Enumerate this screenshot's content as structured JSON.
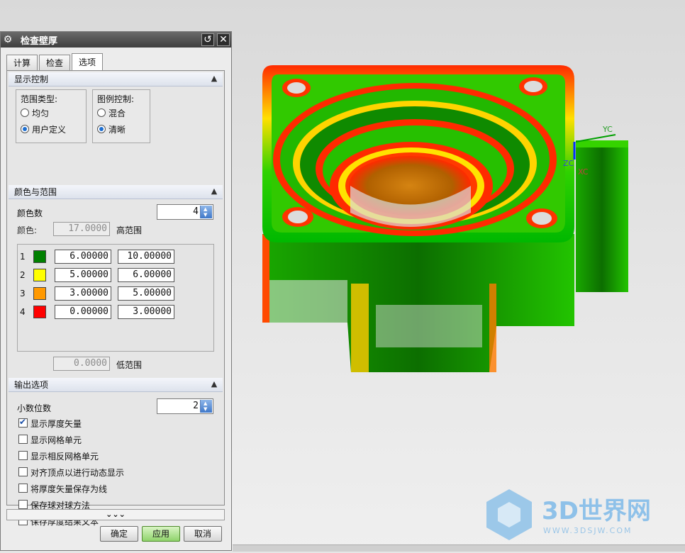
{
  "dialog": {
    "title": "检查壁厚",
    "tabs": [
      {
        "label": "计算",
        "active": false
      },
      {
        "label": "检查",
        "active": false
      },
      {
        "label": "选项",
        "active": true
      }
    ],
    "display_control": {
      "header": "显示控制",
      "range_type": {
        "label": "范围类型:",
        "options": [
          {
            "label": "均匀",
            "selected": false
          },
          {
            "label": "用户定义",
            "selected": true
          }
        ]
      },
      "legend_control": {
        "label": "图例控制:",
        "options": [
          {
            "label": "混合",
            "selected": false
          },
          {
            "label": "清晰",
            "selected": true
          }
        ]
      }
    },
    "color_range": {
      "header": "颜色与范围",
      "color_count_label": "颜色数",
      "color_count_value": "4",
      "color_label": "颜色:",
      "color_high_value": "17.0000",
      "high_range_label": "高范围",
      "rows": [
        {
          "index": "1",
          "color": "#008000",
          "low": "6.00000",
          "high": "10.00000"
        },
        {
          "index": "2",
          "color": "#ffff00",
          "low": "5.00000",
          "high": "6.00000"
        },
        {
          "index": "3",
          "color": "#ff9900",
          "low": "3.00000",
          "high": "5.00000"
        },
        {
          "index": "4",
          "color": "#ff0000",
          "low": "0.00000",
          "high": "3.00000"
        }
      ],
      "low_value": "0.0000",
      "low_range_label": "低范围"
    },
    "output": {
      "header": "输出选项",
      "decimal_label": "小数位数",
      "decimal_value": "2",
      "checkboxes": [
        {
          "label": "显示厚度矢量",
          "checked": true
        },
        {
          "label": "显示网格单元",
          "checked": false
        },
        {
          "label": "显示相反网格单元",
          "checked": false
        },
        {
          "label": "对齐顶点以进行动态显示",
          "checked": false
        },
        {
          "label": "将厚度矢量保存为线",
          "checked": false
        },
        {
          "label": "保存球对球方法",
          "checked": false
        },
        {
          "label": "保存厚度结果文本",
          "checked": false
        }
      ]
    },
    "more_glyph": "⌄⌄⌄",
    "buttons": {
      "ok": "确定",
      "apply": "应用",
      "cancel": "取消"
    }
  },
  "viewport": {
    "axis_labels": {
      "yc": "YC",
      "zc": "ZC",
      "xc": "XC"
    }
  },
  "watermark": {
    "text": "3D世界网",
    "subtext": "WWW.3DSJW.COM"
  },
  "icons": {
    "settings": "gear-icon",
    "reset": "reset-icon",
    "close": "close-icon"
  }
}
